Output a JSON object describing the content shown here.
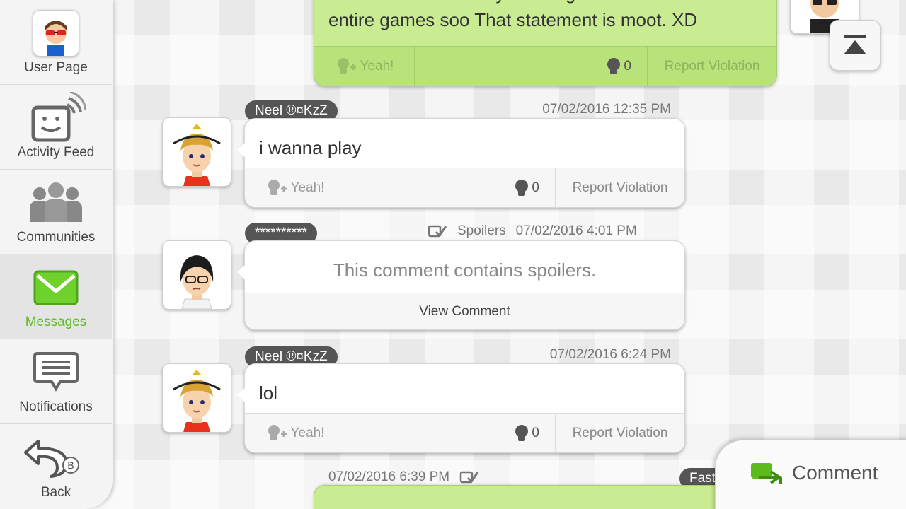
{
  "sidebar": {
    "items": [
      {
        "label": "User Page",
        "icon": "user-mii-icon"
      },
      {
        "label": "Activity Feed",
        "icon": "activity-feed-icon"
      },
      {
        "label": "Communities",
        "icon": "communities-icon"
      },
      {
        "label": "Messages",
        "icon": "envelope-icon",
        "active": true
      },
      {
        "label": "Notifications",
        "icon": "speech-bubble-icon"
      },
      {
        "label": "Back",
        "icon": "back-arrow-icon",
        "key_hint": "B"
      }
    ]
  },
  "posts": {
    "top": {
      "text_line1": "Well shein im actually learning to create",
      "text_line2": "entire games soo That statement is moot. XD",
      "yeah_label": "Yeah!",
      "empathy_count": "0",
      "report_label": "Report Violation"
    },
    "p1": {
      "author": "Neel ®¤KzZ",
      "timestamp": "07/02/2016 12:35 PM",
      "text": "i wanna play",
      "yeah_label": "Yeah!",
      "empathy_count": "0",
      "report_label": "Report Violation"
    },
    "p2": {
      "author": "**********",
      "spoiler_tag": "Spoilers",
      "timestamp": "07/02/2016 4:01 PM",
      "spoiler_text": "This comment contains spoilers.",
      "view_label": "View Comment"
    },
    "p3": {
      "author": "Neel ®¤KzZ",
      "timestamp": "07/02/2016 6:24 PM",
      "text": "lol",
      "yeah_label": "Yeah!",
      "empathy_count": "0",
      "report_label": "Report Violation"
    },
    "bottom": {
      "timestamp": "07/02/2016 6:39 PM",
      "author_partial": "Fast"
    }
  },
  "actions": {
    "comment_label": "Comment"
  },
  "colors": {
    "accent_green": "#5cbc1e",
    "own_post_green": "#c9ec92"
  }
}
